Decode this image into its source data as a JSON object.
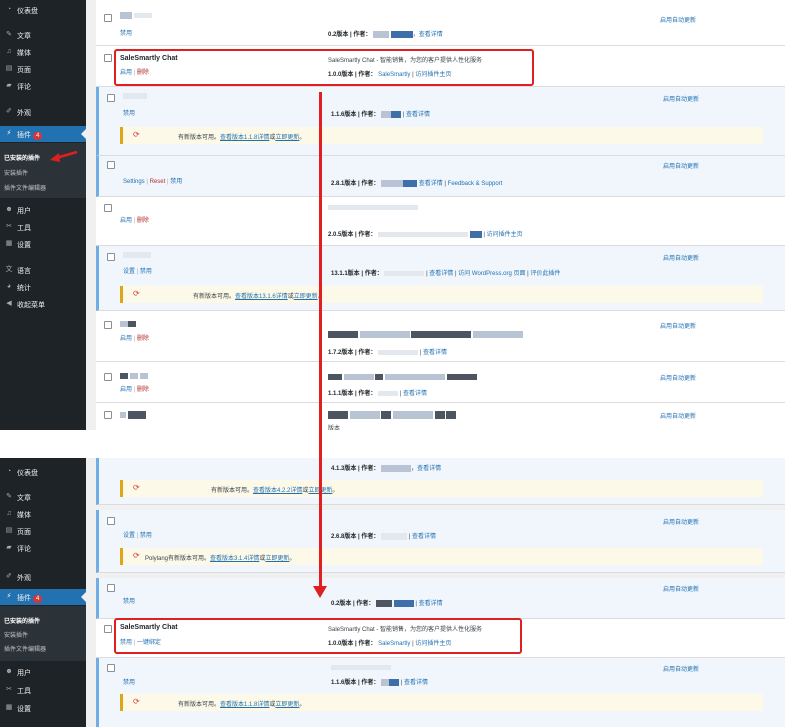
{
  "menu": {
    "dashboard": "仪表盘",
    "posts": "文章",
    "media": "媒体",
    "pages": "页面",
    "comments": "评论",
    "appearance": "外观",
    "plugins": "插件",
    "plugins_badge": "4",
    "users": "用户",
    "tools": "工具",
    "settings": "设置",
    "language": "语言",
    "stats": "统计",
    "collapse": "收起菜单"
  },
  "submenu": {
    "installed": "已安装的插件",
    "add_new": "安装插件",
    "editor": "插件文件编辑器"
  },
  "icons": [
    "dashboard-icon",
    "pin-icon",
    "media-icon",
    "page-icon",
    "comment-icon",
    "brush-icon",
    "plugin-icon",
    "user-icon",
    "wrench-icon",
    "settings-icon",
    "translate-icon",
    "chart-icon",
    "collapse-icon",
    "update-icon",
    "checkbox-icon",
    "screenshot-icon"
  ],
  "colors": {
    "accent": "#2271b1",
    "sidebar": "#1d2327",
    "highlight": "#e02020",
    "delete": "#b32d2e",
    "notice": "#dba617"
  },
  "common": {
    "disable": "禁用",
    "enable": "启用",
    "delete": "删除",
    "auto_update": "启用自动更新",
    "author": "作者：",
    "view_details": "查看详情",
    "visit_plugin_site": "访问插件主页",
    "sep": "|",
    "comma": "，"
  },
  "top": {
    "row1": {
      "version": "0.2版本 |"
    },
    "sale": {
      "name": "SaleSmartly Chat",
      "desc": "SaleSmartly Chat - 智能销售，为您的客户提供人性化服务",
      "version": "1.0.0版本 |",
      "author": "SaleSmartly"
    },
    "row3": {
      "version": "1.1.6版本 |"
    },
    "notice1": {
      "pre": "有新版本可用。",
      "link1": "查看版本1.1.8详情",
      "mid": "或",
      "link2": "立即更新",
      "end": "。"
    },
    "row4": {
      "settings": "Settings",
      "reset": "Reset",
      "version": "2.8.1版本 |",
      "feedback": "Feedback & Support"
    },
    "row5": {
      "version": "2.0.5版本 |"
    },
    "row6": {
      "settings": "设置",
      "version": "13.1.1版本 |",
      "wp_org": "访问 WordPress.org 页面",
      "rate": "评价此插件"
    },
    "notice2": {
      "pre": "有新版本可用。",
      "link1": "查看版本13.1.6详情",
      "mid": "或",
      "link2": "立即更新",
      "end": "。"
    },
    "row7": {
      "version": "1.7.2版本 |"
    },
    "row8": {
      "version": "1.1.1版本 |"
    },
    "row9": {
      "version": "版本"
    }
  },
  "bottom": {
    "row0": {
      "version": "4.1.3版本 |"
    },
    "notice0": {
      "pre": "有新版本可用。",
      "link1": "查看版本4.2.2详情",
      "mid": "或",
      "link2": "立即更新",
      "end": "。"
    },
    "row1": {
      "settings": "设置",
      "version": "2.6.8版本 |"
    },
    "notice1": {
      "pre": "Polylang有新版本可用。",
      "link1": "查看版本3.1.4详情",
      "mid": "或",
      "link2": "立即更新",
      "end": "。"
    },
    "row2": {
      "version": "0.2版本 |"
    },
    "sale": {
      "name": "SaleSmartly Chat",
      "desc": "SaleSmartly Chat - 智能销售，为您的客户提供人性化服务",
      "version": "1.0.0版本 |",
      "author": "SaleSmartly",
      "bind_action": "一键绑定"
    },
    "row4": {
      "version": "1.1.6版本 |"
    },
    "notice2": {
      "pre": "有新版本可用。",
      "link1": "查看版本1.1.8详情",
      "mid": "或",
      "link2": "立即更新",
      "end": "。"
    }
  }
}
